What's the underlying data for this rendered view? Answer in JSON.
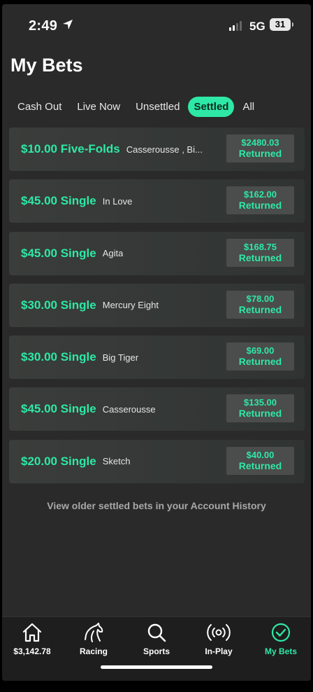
{
  "status": {
    "time": "2:49",
    "network": "5G",
    "battery": "31"
  },
  "page_title": "My Bets",
  "tabs": [
    {
      "label": "Cash Out",
      "active": false
    },
    {
      "label": "Live Now",
      "active": false
    },
    {
      "label": "Unsettled",
      "active": false
    },
    {
      "label": "Settled",
      "active": true
    },
    {
      "label": "All",
      "active": false
    }
  ],
  "bets": [
    {
      "amount": "$10.00 Five-Folds",
      "selection": "Casserousse , Bi...",
      "returned_value": "$2480.03",
      "returned_label": "Returned"
    },
    {
      "amount": "$45.00 Single",
      "selection": "In Love",
      "returned_value": "$162.00",
      "returned_label": "Returned"
    },
    {
      "amount": "$45.00 Single",
      "selection": "Agita",
      "returned_value": "$168.75",
      "returned_label": "Returned"
    },
    {
      "amount": "$30.00 Single",
      "selection": "Mercury Eight",
      "returned_value": "$78.00",
      "returned_label": "Returned"
    },
    {
      "amount": "$30.00 Single",
      "selection": "Big Tiger",
      "returned_value": "$69.00",
      "returned_label": "Returned"
    },
    {
      "amount": "$45.00 Single",
      "selection": "Casserousse",
      "returned_value": "$135.00",
      "returned_label": "Returned"
    },
    {
      "amount": "$20.00 Single",
      "selection": "Sketch",
      "returned_value": "$40.00",
      "returned_label": "Returned"
    }
  ],
  "history_link": "View older settled bets in your Account History",
  "nav": [
    {
      "label": "$3,142.78",
      "icon": "home-icon"
    },
    {
      "label": "Racing",
      "icon": "horse-icon"
    },
    {
      "label": "Sports",
      "icon": "search-icon"
    },
    {
      "label": "In-Play",
      "icon": "broadcast-icon"
    },
    {
      "label": "My Bets",
      "icon": "check-circle-icon",
      "active": true
    }
  ],
  "colors": {
    "accent": "#2ee8a6",
    "background": "#2a2a2a",
    "card": "#363937",
    "nav": "#1e1e1e"
  }
}
